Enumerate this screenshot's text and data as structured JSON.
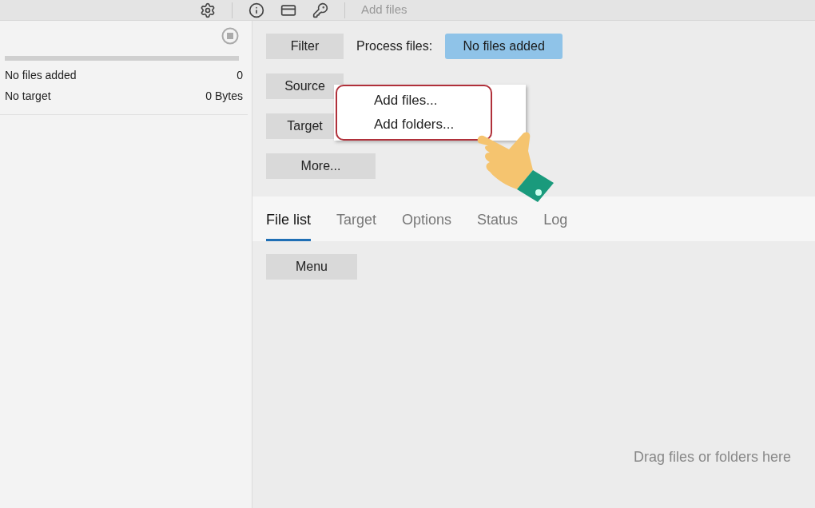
{
  "toolbar": {
    "label": "Add files"
  },
  "sidebar": {
    "rows": [
      {
        "label": "No files added",
        "value": "0"
      },
      {
        "label": "No target",
        "value": "0 Bytes"
      }
    ]
  },
  "controls": {
    "buttons": [
      {
        "label": "Filter"
      },
      {
        "label": "Source"
      },
      {
        "label": "Target"
      },
      {
        "label": "More..."
      }
    ],
    "process_label": "Process files:",
    "process_value": "No files added"
  },
  "dropdown": {
    "items": [
      {
        "label": "Add files..."
      },
      {
        "label": "Add folders..."
      }
    ]
  },
  "tabs": [
    {
      "label": "File list",
      "selected": true
    },
    {
      "label": "Target",
      "selected": false
    },
    {
      "label": "Options",
      "selected": false
    },
    {
      "label": "Status",
      "selected": false
    },
    {
      "label": "Log",
      "selected": false
    }
  ],
  "file_list": {
    "menu_button": "Menu",
    "empty_hint": "Drag files or folders here"
  }
}
